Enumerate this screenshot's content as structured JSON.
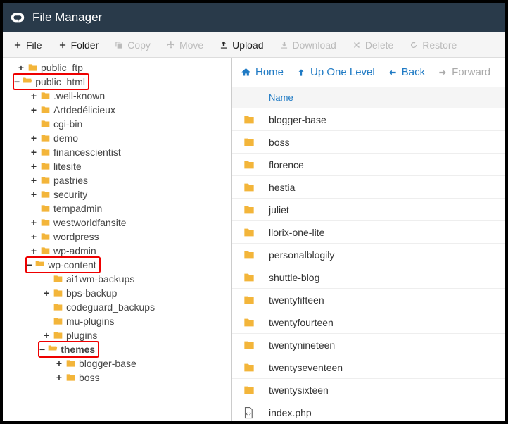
{
  "title": "File Manager",
  "toolbar": {
    "file": "File",
    "folder": "Folder",
    "copy": "Copy",
    "move": "Move",
    "upload": "Upload",
    "download": "Download",
    "delete": "Delete",
    "restore": "Restore"
  },
  "nav": {
    "home": "Home",
    "up": "Up One Level",
    "back": "Back",
    "forward": "Forward"
  },
  "listHeader": "Name",
  "tree": {
    "public_ftp": "public_ftp",
    "public_html": "public_html",
    "well_known": ".well-known",
    "artdede": "Artdedélicieux",
    "cgi_bin": "cgi-bin",
    "demo": "demo",
    "financescientist": "financescientist",
    "litesite": "litesite",
    "pastries": "pastries",
    "security": "security",
    "tempadmin": "tempadmin",
    "westworldfansite": "westworldfansite",
    "wordpress": "wordpress",
    "wp_admin": "wp-admin",
    "wp_content": "wp-content",
    "ai1wm": "ai1wm-backups",
    "bps": "bps-backup",
    "codeguard": "codeguard_backups",
    "mu_plugins": "mu-plugins",
    "plugins": "plugins",
    "themes": "themes",
    "blogger_base": "blogger-base",
    "boss": "boss"
  },
  "files": [
    {
      "name": "blogger-base",
      "type": "folder"
    },
    {
      "name": "boss",
      "type": "folder"
    },
    {
      "name": "florence",
      "type": "folder"
    },
    {
      "name": "hestia",
      "type": "folder"
    },
    {
      "name": "juliet",
      "type": "folder"
    },
    {
      "name": "llorix-one-lite",
      "type": "folder"
    },
    {
      "name": "personalblogily",
      "type": "folder"
    },
    {
      "name": "shuttle-blog",
      "type": "folder"
    },
    {
      "name": "twentyfifteen",
      "type": "folder"
    },
    {
      "name": "twentyfourteen",
      "type": "folder"
    },
    {
      "name": "twentynineteen",
      "type": "folder"
    },
    {
      "name": "twentyseventeen",
      "type": "folder"
    },
    {
      "name": "twentysixteen",
      "type": "folder"
    },
    {
      "name": "index.php",
      "type": "file"
    }
  ]
}
